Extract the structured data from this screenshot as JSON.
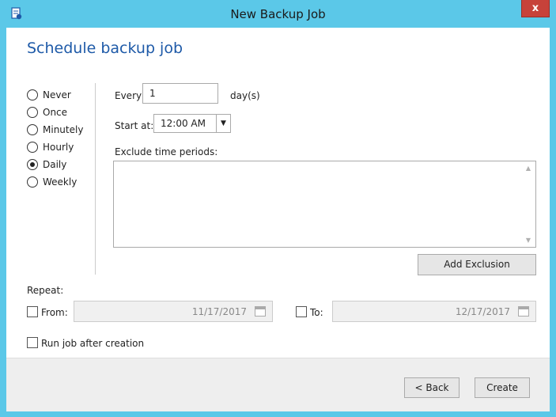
{
  "window": {
    "title": "New Backup Job",
    "close_label": "x"
  },
  "heading": "Schedule backup job",
  "frequency": {
    "options": [
      "Never",
      "Once",
      "Minutely",
      "Hourly",
      "Daily",
      "Weekly"
    ],
    "selected": "Daily"
  },
  "every": {
    "label": "Every",
    "value": "1",
    "unit": "day(s)"
  },
  "start": {
    "label": "Start at:",
    "value": "12:00 AM"
  },
  "exclude": {
    "label": "Exclude time periods:",
    "add_button": "Add Exclusion"
  },
  "repeat": {
    "label": "Repeat:",
    "from_label": "From:",
    "from_value": "11/17/2017",
    "to_label": "To:",
    "to_value": "12/17/2017"
  },
  "run_after": {
    "label": "Run job after creation"
  },
  "footer": {
    "back_label": "< Back",
    "create_label": "Create"
  },
  "colors": {
    "titlebar": "#5bc8e8",
    "heading": "#1e5aa8",
    "close": "#c7423a"
  }
}
